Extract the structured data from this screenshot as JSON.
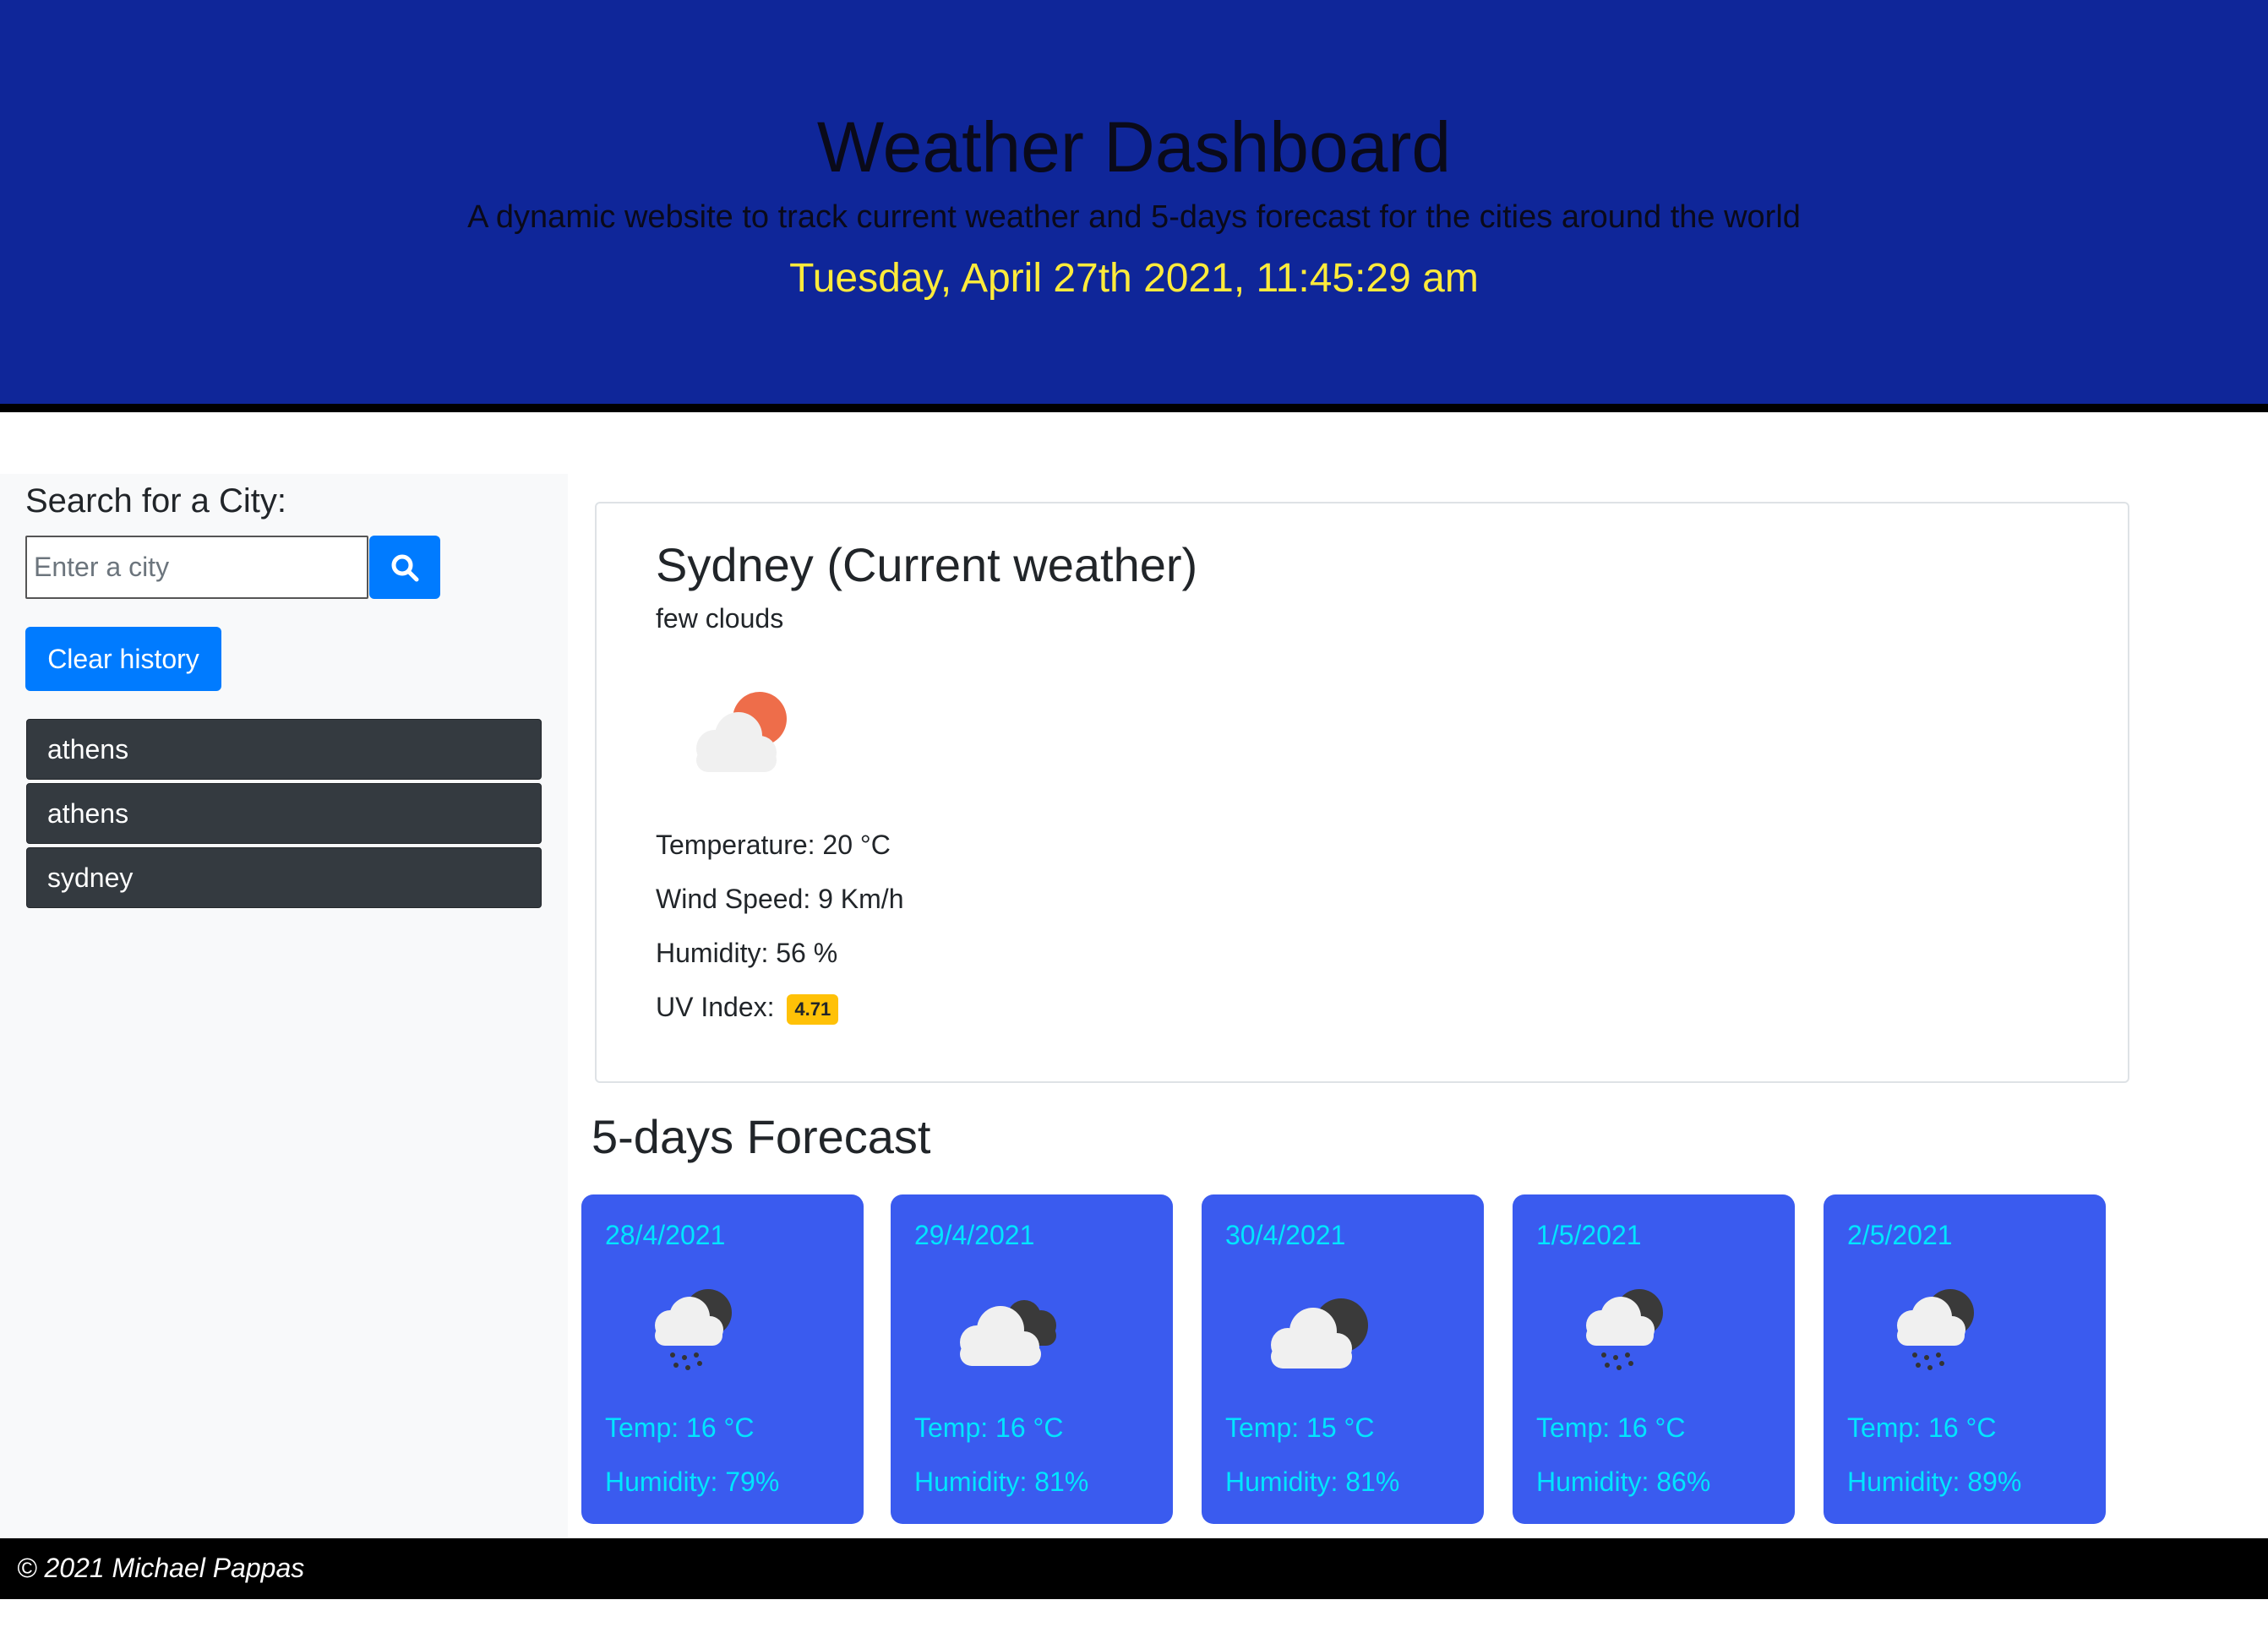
{
  "header": {
    "title": "Weather Dashboard",
    "subtitle": "A dynamic website to track current weather and 5-days forecast for the cities around the world",
    "datetime": "Tuesday, April 27th 2021, 11:45:29 am"
  },
  "sidebar": {
    "search_label": "Search for a City:",
    "search_placeholder": "Enter a city",
    "search_icon": "search-icon",
    "clear_label": "Clear history",
    "history": [
      "athens",
      "athens",
      "sydney"
    ]
  },
  "current": {
    "city": "Sydney (Current weather)",
    "description": "few clouds",
    "icon": "few-clouds-icon",
    "temperature": "Temperature: 20 °C",
    "wind": "Wind Speed: 9 Km/h",
    "humidity": "Humidity: 56 %",
    "uv_label": "UV Index:",
    "uv_value": "4.71"
  },
  "forecast": {
    "title": "5-days Forecast",
    "days": [
      {
        "date": "28/4/2021",
        "icon": "rain-icon",
        "temp": "Temp: 16 °C",
        "humidity": "Humidity: 79%"
      },
      {
        "date": "29/4/2021",
        "icon": "broken-clouds-icon",
        "temp": "Temp: 16 °C",
        "humidity": "Humidity: 81%"
      },
      {
        "date": "30/4/2021",
        "icon": "overcast-clouds-icon",
        "temp": "Temp: 15 °C",
        "humidity": "Humidity: 81%"
      },
      {
        "date": "1/5/2021",
        "icon": "rain-icon",
        "temp": "Temp: 16 °C",
        "humidity": "Humidity: 86%"
      },
      {
        "date": "2/5/2021",
        "icon": "rain-icon",
        "temp": "Temp: 16 °C",
        "humidity": "Humidity: 89%"
      }
    ]
  },
  "footer": {
    "text": "© 2021 Michael Pappas"
  },
  "colors": {
    "header_bg": "#0f2699",
    "datetime": "#ffeb3b",
    "primary": "#007bff",
    "history_bg": "#343a40",
    "card_bg": "#3a5bef",
    "card_text": "#00e5ff",
    "uv_badge": "#ffc107"
  }
}
